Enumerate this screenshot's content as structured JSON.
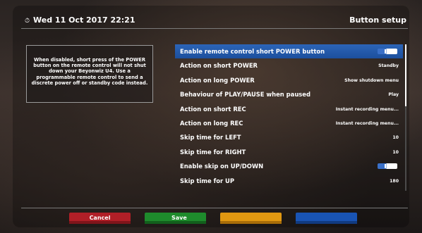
{
  "header": {
    "datetime": "Wed 11 Oct 2017  22:21",
    "title": "Button setup"
  },
  "help_text": "When disabled, short press of the POWER button on the remote control will not shut down your Beyonwiz U4. Use a programmable remote control to send a discrete power off or standby code instead.",
  "menu": {
    "items": [
      {
        "label": "Enable remote control short POWER button",
        "value": "",
        "toggle": "on",
        "selected": true
      },
      {
        "label": "Action on short POWER",
        "value": "Standby"
      },
      {
        "label": "Action on long POWER",
        "value": "Show shutdown menu"
      },
      {
        "label": "Behaviour of PLAY/PAUSE when paused",
        "value": "Play"
      },
      {
        "label": "Action on short REC",
        "value": "Instant recording menu..."
      },
      {
        "label": "Action on long REC",
        "value": "Instant recording menu..."
      },
      {
        "label": "Skip time for LEFT",
        "value": "10"
      },
      {
        "label": "Skip time for RIGHT",
        "value": "10"
      },
      {
        "label": "Enable skip on UP/DOWN",
        "value": "",
        "toggle": "on"
      },
      {
        "label": "Skip time for UP",
        "value": "180"
      }
    ]
  },
  "buttons": {
    "red": "Cancel",
    "green": "Save",
    "yellow": "",
    "blue": ""
  },
  "colors": {
    "selected_row": "#2c65b8",
    "red": "#b11f27",
    "green": "#1e8b2c",
    "yellow": "#e19811",
    "blue": "#1954b4"
  }
}
